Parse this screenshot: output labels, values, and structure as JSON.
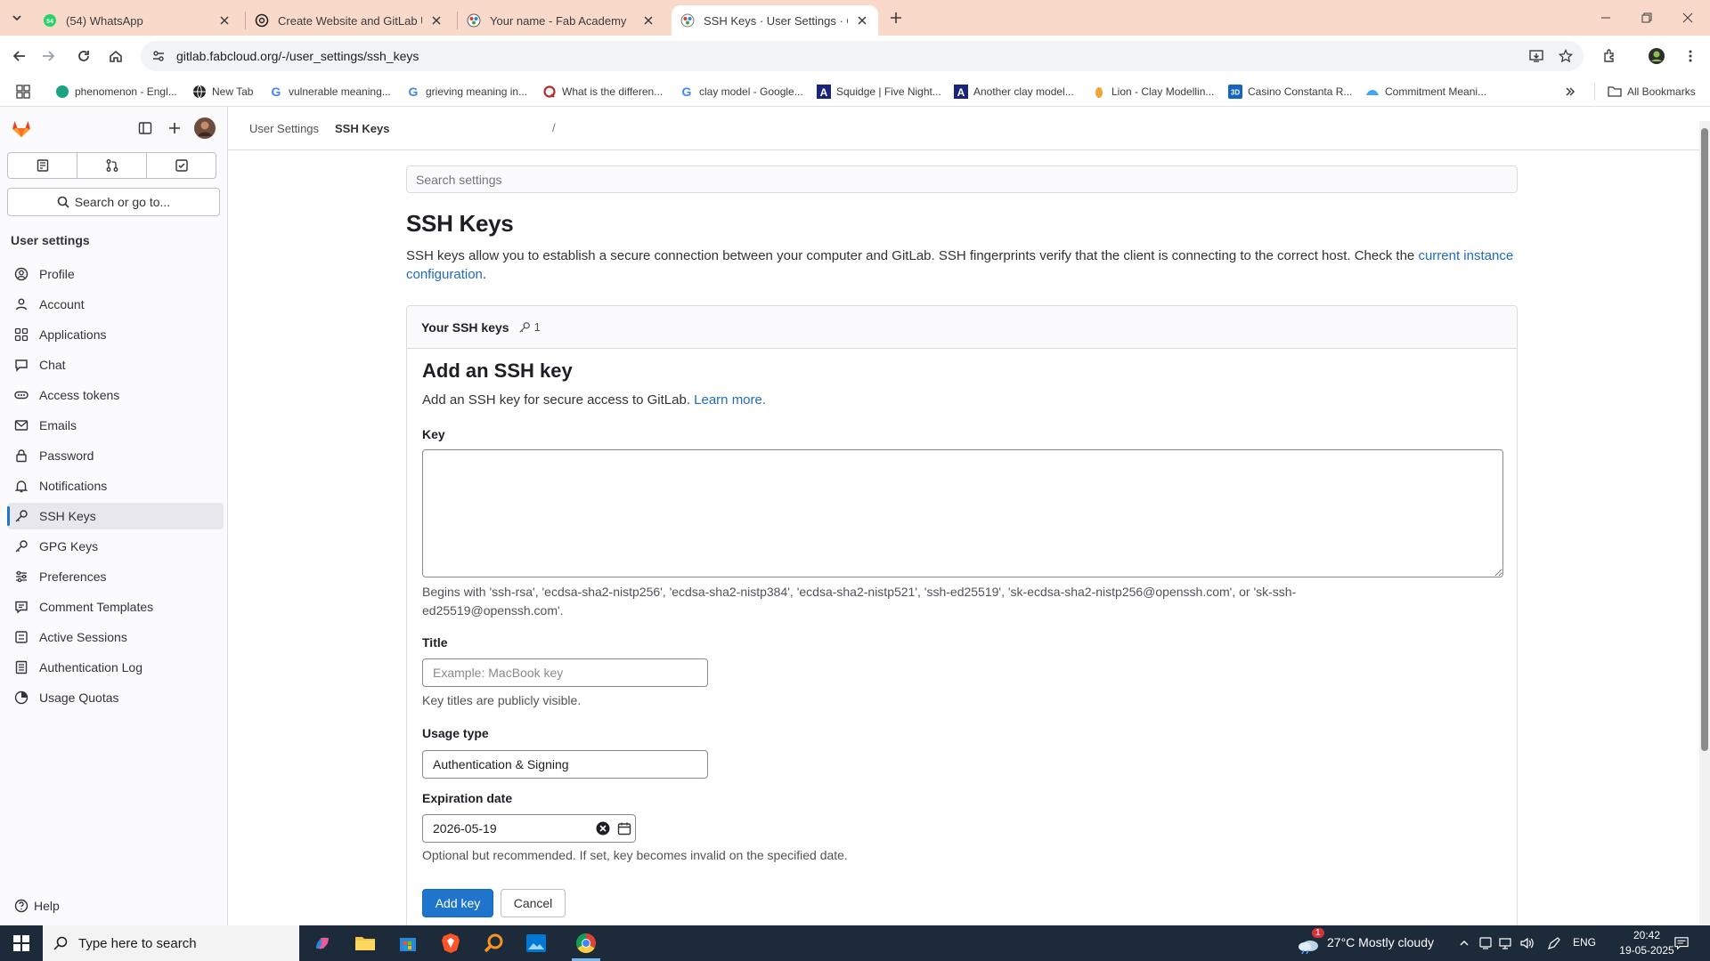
{
  "browser": {
    "tabs": [
      {
        "title": "(54) WhatsApp",
        "icon": "whatsapp-icon"
      },
      {
        "title": "Create Website and GitLab Uplo",
        "icon": "chatgpt-icon"
      },
      {
        "title": "Your name - Fab Academy",
        "icon": "fab-academy-icon"
      },
      {
        "title": "SSH Keys · User Settings · GitLab",
        "icon": "gitlab-icon"
      }
    ],
    "url": "gitlab.fabcloud.org/-/user_settings/ssh_keys",
    "bookmarks": [
      "phenomenon - Engl...",
      "New Tab",
      "vulnerable meaning...",
      "grieving meaning in...",
      "What is the differen...",
      "clay model - Google...",
      "Squidge | Five Night...",
      "Another clay model...",
      "Lion - Clay Modellin...",
      "Casino Constanta R...",
      "Commitment Meani..."
    ],
    "all_bookmarks": "All Bookmarks"
  },
  "sidebar": {
    "search": "Search or go to...",
    "heading": "User settings",
    "items": [
      {
        "label": "Profile",
        "icon": "profile-icon"
      },
      {
        "label": "Account",
        "icon": "account-icon"
      },
      {
        "label": "Applications",
        "icon": "applications-icon"
      },
      {
        "label": "Chat",
        "icon": "chat-icon"
      },
      {
        "label": "Access tokens",
        "icon": "token-icon"
      },
      {
        "label": "Emails",
        "icon": "mail-icon"
      },
      {
        "label": "Password",
        "icon": "lock-icon"
      },
      {
        "label": "Notifications",
        "icon": "bell-icon"
      },
      {
        "label": "SSH Keys",
        "icon": "key-icon"
      },
      {
        "label": "GPG Keys",
        "icon": "key-icon"
      },
      {
        "label": "Preferences",
        "icon": "preferences-icon"
      },
      {
        "label": "Comment Templates",
        "icon": "comment-icon"
      },
      {
        "label": "Active Sessions",
        "icon": "sessions-icon"
      },
      {
        "label": "Authentication Log",
        "icon": "log-icon"
      },
      {
        "label": "Usage Quotas",
        "icon": "quota-icon"
      }
    ],
    "active_index": 8,
    "help": "Help"
  },
  "breadcrumb": {
    "parent": "User Settings",
    "separator": "/",
    "current": "SSH Keys"
  },
  "main": {
    "search_placeholder": "Search settings",
    "title": "SSH Keys",
    "description": "SSH keys allow you to establish a secure connection between your computer and GitLab. SSH fingerprints verify that the client is connecting to the correct host. Check the",
    "description_link": "current instance configuration",
    "description_end": ".",
    "card": {
      "header_title": "Your SSH keys",
      "key_count": "1",
      "form_title": "Add an SSH key",
      "form_sub": "Add an SSH key for secure access to GitLab.",
      "learn_more": "Learn more.",
      "key_label": "Key",
      "key_value": "",
      "key_help": "Begins with 'ssh-rsa', 'ecdsa-sha2-nistp256', 'ecdsa-sha2-nistp384', 'ecdsa-sha2-nistp521', 'ssh-ed25519', 'sk-ecdsa-sha2-nistp256@openssh.com', or 'sk-ssh-ed25519@openssh.com'.",
      "title_label": "Title",
      "title_placeholder": "Example: MacBook key",
      "title_help": "Key titles are publicly visible.",
      "usage_label": "Usage type",
      "usage_value": "Authentication & Signing",
      "expiration_label": "Expiration date",
      "expiration_value": "2026-05-19",
      "expiration_help": "Optional but recommended. If set, key becomes invalid on the specified date.",
      "add_button": "Add key",
      "cancel_button": "Cancel"
    }
  },
  "taskbar": {
    "search_placeholder": "Type here to search",
    "weather": "27°C  Mostly cloudy",
    "weather_badge": "1",
    "language": "ENG",
    "time": "20:42",
    "date": "19-05-2025"
  },
  "colors": {
    "accent": "#1f75cb",
    "link": "#1f6bc4",
    "tabstrip": "#f9d9c9",
    "taskbar": "#1c2a3a"
  }
}
